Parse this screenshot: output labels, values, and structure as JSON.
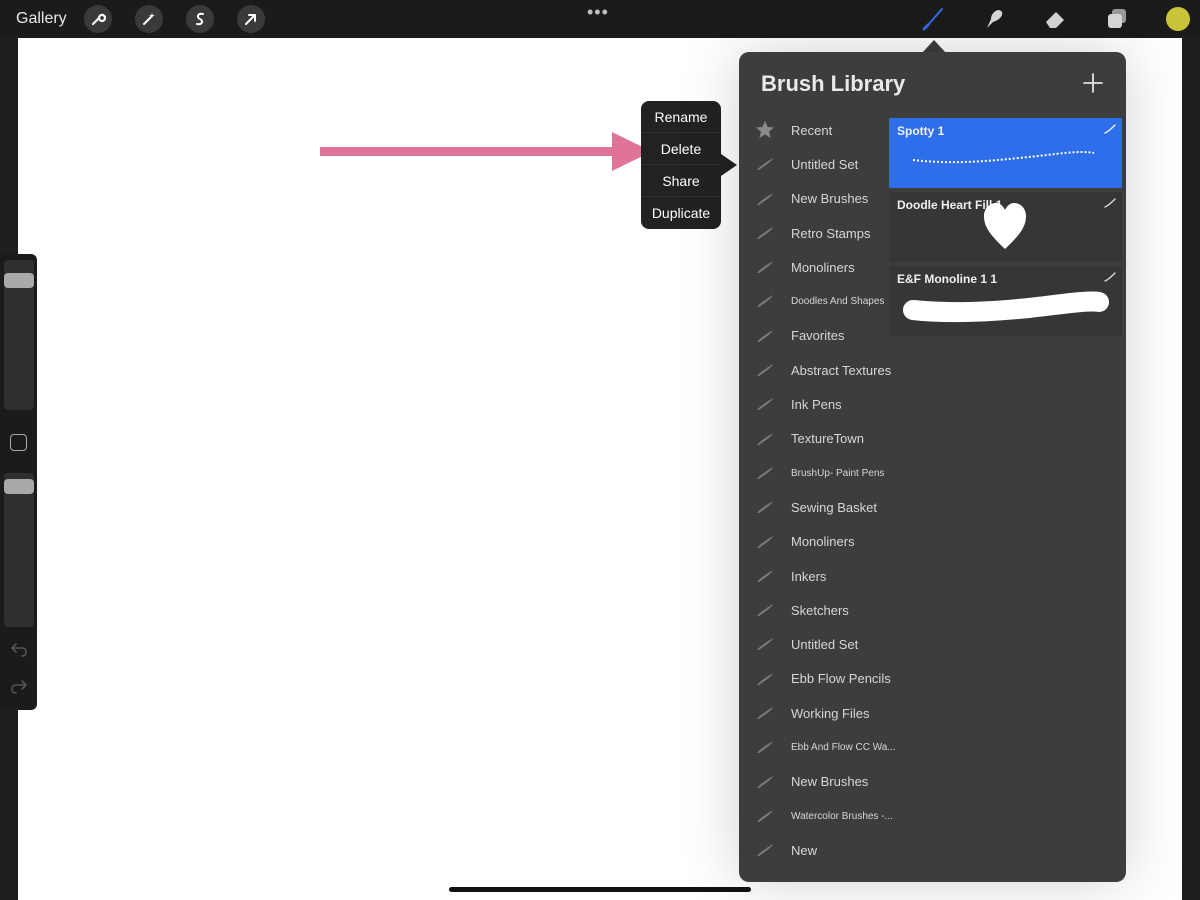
{
  "toolbar": {
    "gallery_label": "Gallery",
    "icons": [
      "wrench-icon",
      "magic-wand-icon",
      "selection-icon",
      "transform-arrow-icon"
    ],
    "more_label": "•••",
    "right_icons": [
      "brush-icon",
      "smudge-icon",
      "eraser-icon",
      "layers-icon"
    ],
    "brush_color": "#2f6eea",
    "current_color": "#c9c33a"
  },
  "context_menu": {
    "items": [
      "Rename",
      "Delete",
      "Share",
      "Duplicate"
    ]
  },
  "annotation": {
    "arrow_color": "#e0739a"
  },
  "panel": {
    "title": "Brush Library",
    "add_icon": "plus-icon",
    "sets": [
      {
        "label": "Recent",
        "icon": "star-icon"
      },
      {
        "label": "Untitled Set",
        "icon": "brush-set-icon"
      },
      {
        "label": "New Brushes",
        "icon": "brush-set-icon"
      },
      {
        "label": "Retro Stamps",
        "icon": "brush-set-icon"
      },
      {
        "label": "Monoliners",
        "icon": "brush-set-icon"
      },
      {
        "label": "Doodles And Shapes",
        "icon": "brush-set-icon",
        "small": true
      },
      {
        "label": "Favorites",
        "icon": "brush-set-icon"
      },
      {
        "label": "Abstract Textures",
        "icon": "brush-set-icon"
      },
      {
        "label": "Ink Pens",
        "icon": "brush-set-icon"
      },
      {
        "label": "TextureTown",
        "icon": "brush-set-icon"
      },
      {
        "label": "BrushUp- Paint Pens",
        "icon": "brush-set-icon",
        "small": true
      },
      {
        "label": "Sewing Basket",
        "icon": "brush-set-icon"
      },
      {
        "label": "Monoliners",
        "icon": "brush-set-icon"
      },
      {
        "label": "Inkers",
        "icon": "brush-set-icon"
      },
      {
        "label": "Sketchers",
        "icon": "brush-set-icon"
      },
      {
        "label": "Untitled Set",
        "icon": "brush-set-icon"
      },
      {
        "label": "Ebb Flow Pencils",
        "icon": "brush-set-icon"
      },
      {
        "label": "Working Files",
        "icon": "brush-set-icon"
      },
      {
        "label": "Ebb And Flow CC Wa...",
        "icon": "brush-set-icon",
        "small": true
      },
      {
        "label": "New Brushes",
        "icon": "brush-set-icon"
      },
      {
        "label": "Watercolor Brushes -...",
        "icon": "brush-set-icon",
        "small": true
      },
      {
        "label": "New",
        "icon": "brush-set-icon"
      }
    ],
    "brushes": [
      {
        "name": "Spotty 1",
        "selected": true,
        "stroke": "dotted-line"
      },
      {
        "name": "Doodle Heart Fill 1",
        "selected": false,
        "stroke": "heart"
      },
      {
        "name": "E&F Monoline  1 1",
        "selected": false,
        "stroke": "thick-line"
      }
    ]
  }
}
